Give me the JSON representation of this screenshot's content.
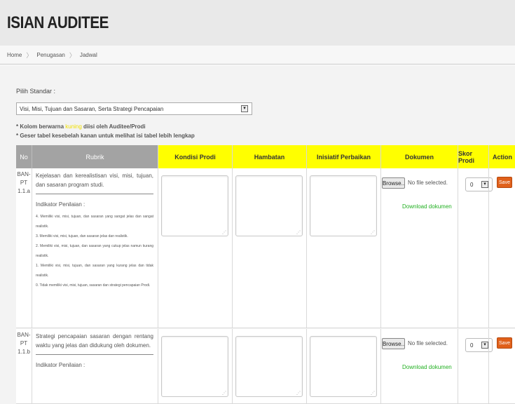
{
  "header": {
    "title": "ISIAN AUDITEE"
  },
  "breadcrumb": {
    "items": [
      "Home",
      "Penugasan",
      "Jadwal"
    ]
  },
  "form": {
    "standard_label": "Pilih Standar :",
    "standard_value": "Visi, Misi, Tujuan dan Sasaran, Serta Strategi Pencapaian"
  },
  "notes": {
    "note1_prefix": "* Kolom berwarna ",
    "note1_highlight": "kuning",
    "note1_suffix": " diisi oleh Auditee/Prodi",
    "note2": "* Geser tabel kesebelah kanan untuk melihat isi tabel lebih lengkap"
  },
  "table": {
    "headers": {
      "no": "No",
      "rubrik": "Rubrik",
      "kondisi": "Kondisi Prodi",
      "hambatan": "Hambatan",
      "inisiatif": "Inisiatif Perbaikan",
      "dokumen": "Dokumen",
      "skor": "Skor Prodi",
      "action": "Action"
    },
    "rows": [
      {
        "no_line1": "BAN-PT",
        "no_line2": "1.1.a",
        "rubrik": "Kejelasan dan kerealistisan visi, misi, tujuan, dan sasaran program studi.",
        "indikator_label": "Indikator Penilaian :",
        "criteria": [
          "4. Memiliki visi, misi, tujuan, dan sasaran yang sangat jelas dan sangat realistik.",
          "3. Memiliki visi, misi, tujuan, dan sasaran jelas dan realistik.",
          "2. Memiliki visi, misi, tujuan, dan sasaran yang cukup jelas namun kurang realistik.",
          "1. Memiliki visi, misi, tujuan, dan sasaran yang kurang jelas dan tidak realistik.",
          "0. Tidak memiliki visi, misi, tujuan, sasaran dan strategi pencapaian Prodi."
        ],
        "browse_label": "Browse..",
        "file_status": "No file selected.",
        "download_label": "Download dokumen",
        "skor_value": "0",
        "save_label": "Save"
      },
      {
        "no_line1": "BAN-PT",
        "no_line2": "1.1.b",
        "rubrik": "Strategi pencapaian sasaran dengan rentang waktu yang jelas dan didukung oleh dokumen.",
        "indikator_label": "Indikator Penilaian :",
        "browse_label": "Browse..",
        "file_status": "No file selected.",
        "download_label": "Download dokumen",
        "skor_value": "0",
        "save_label": "Save"
      }
    ]
  },
  "colors": {
    "accent_yellow": "#ffff00",
    "save_orange": "#e0601a",
    "download_green": "#22b022"
  }
}
